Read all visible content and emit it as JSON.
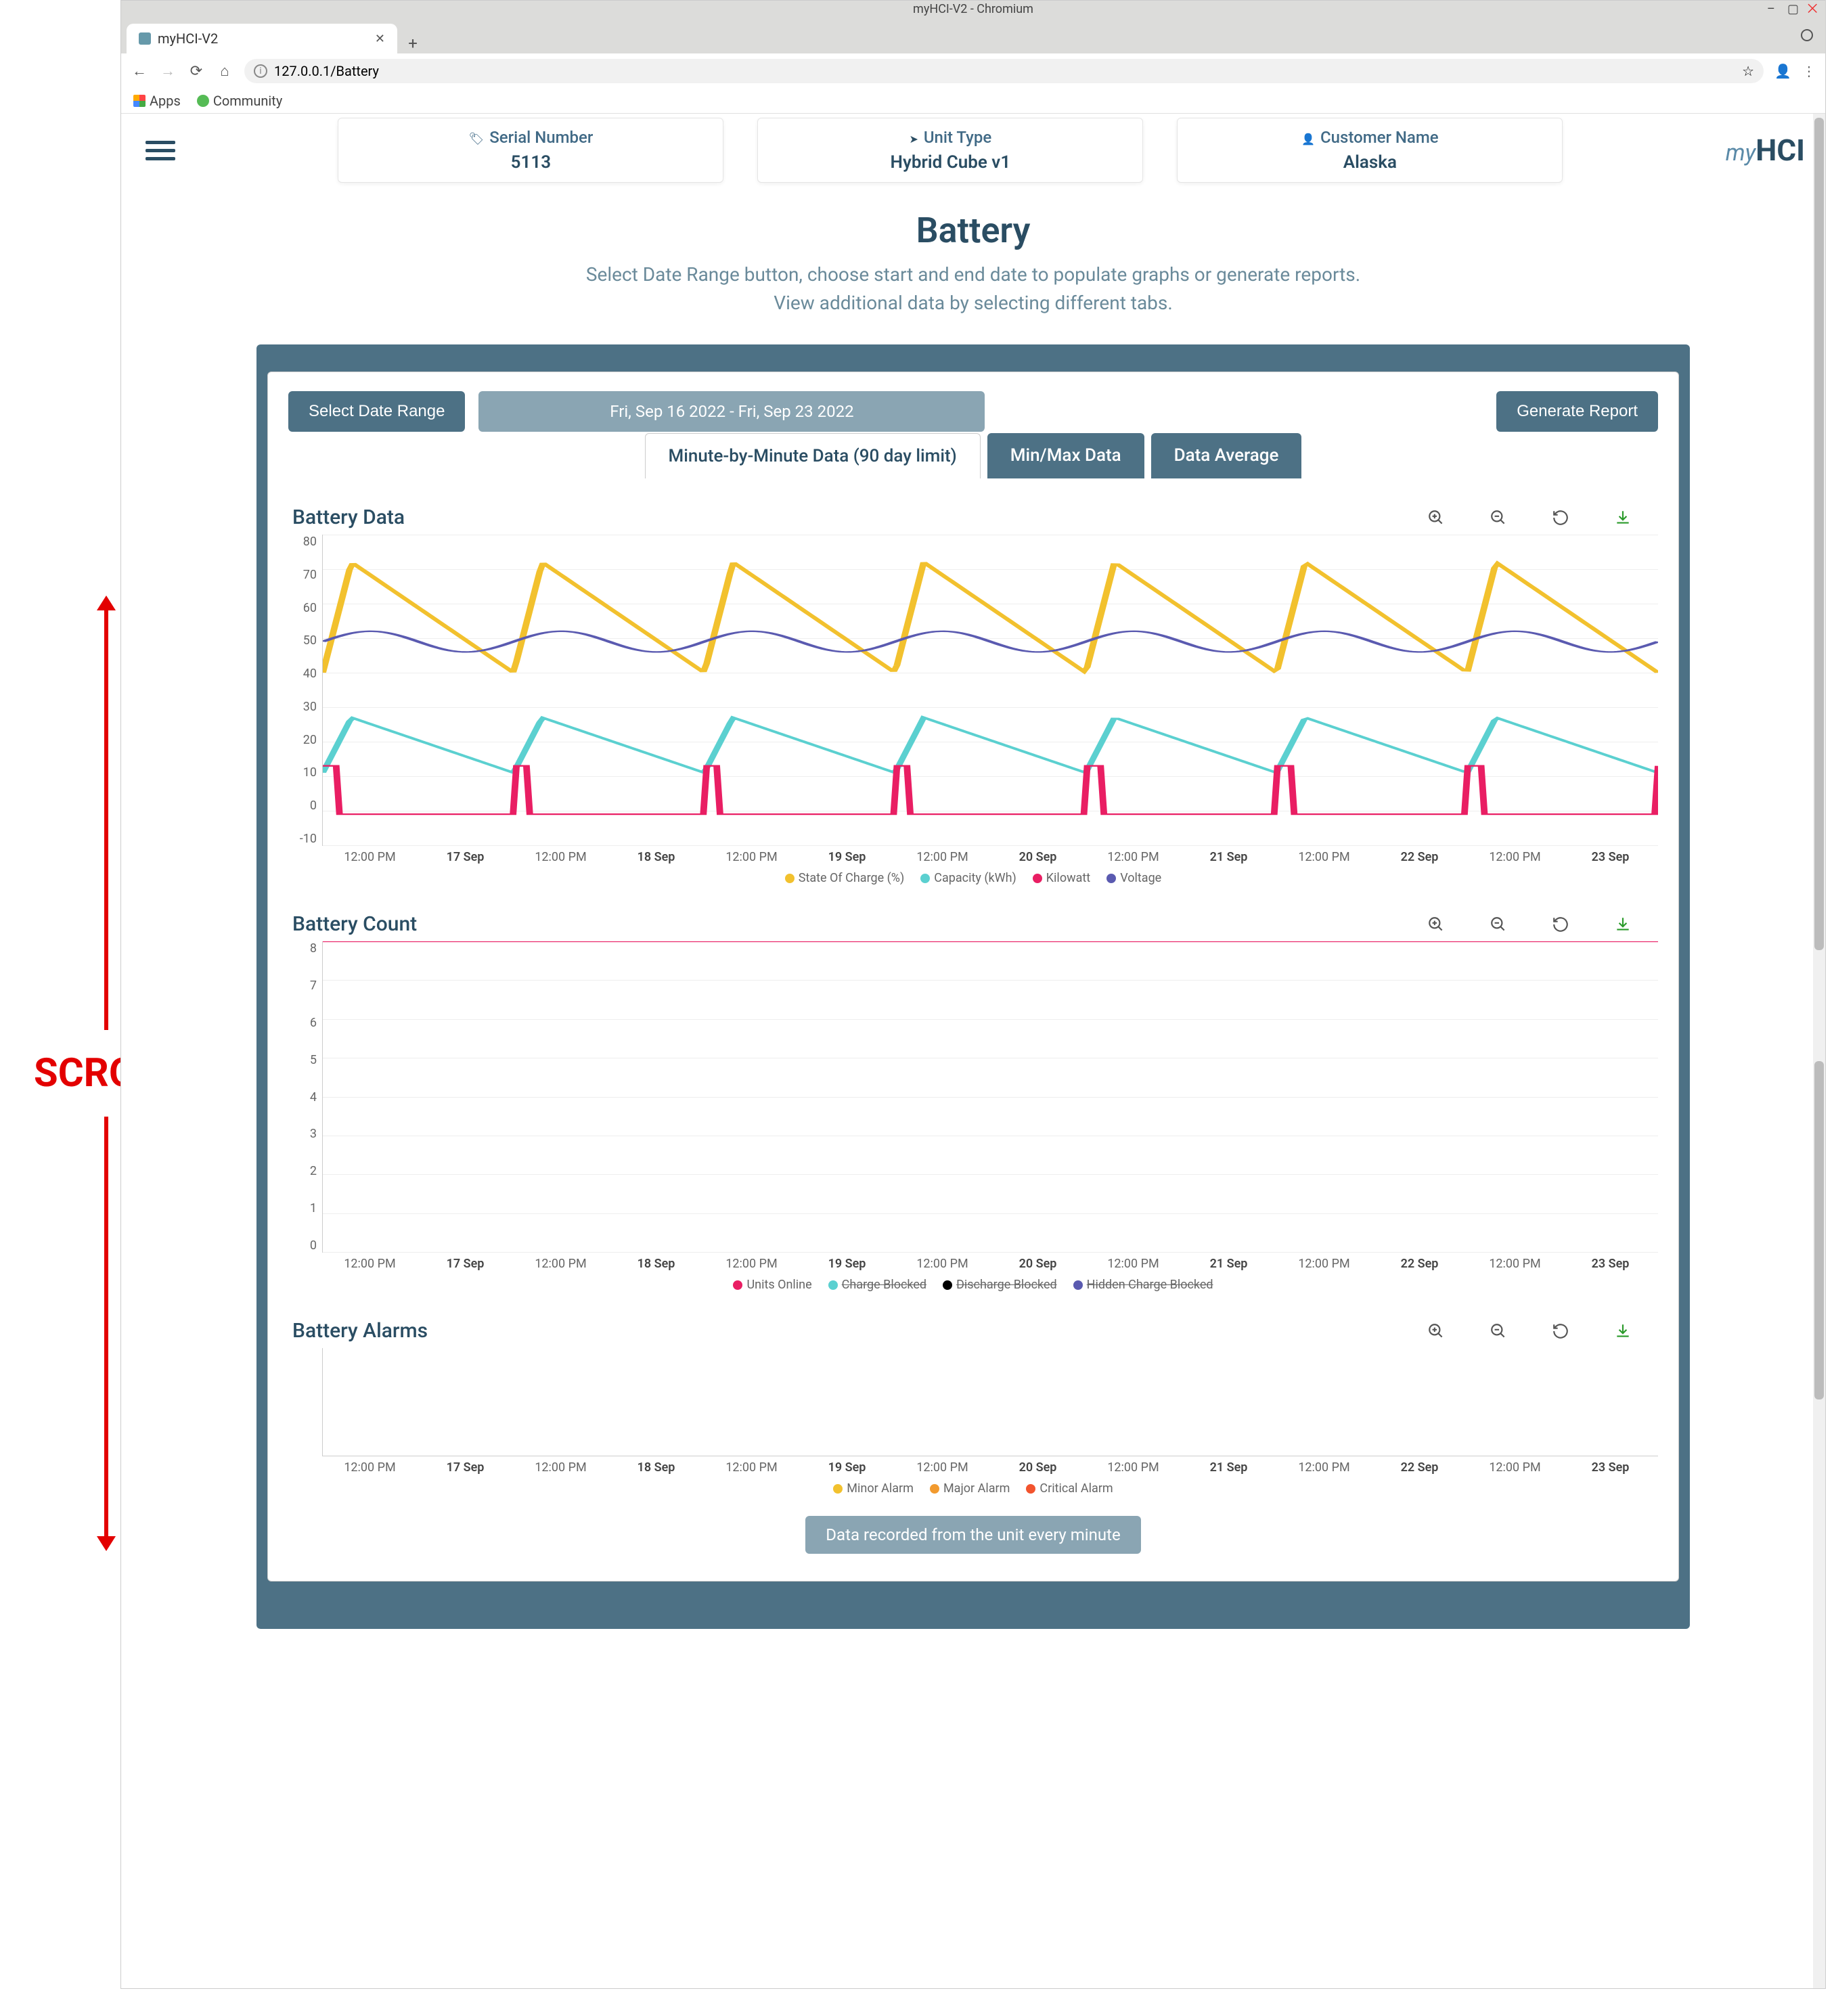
{
  "browser": {
    "window_title": "myHCI-V2 - Chromium",
    "tab_title": "myHCI-V2",
    "url": "127.0.0.1/Battery",
    "bookmarks": {
      "apps": "Apps",
      "community": "Community"
    }
  },
  "annotation": {
    "scroll": "SCROLL"
  },
  "header": {
    "cards": {
      "serial": {
        "label": "Serial Number",
        "value": "5113"
      },
      "unit": {
        "label": "Unit Type",
        "value": "Hybrid Cube v1"
      },
      "cust": {
        "label": "Customer Name",
        "value": "Alaska"
      }
    },
    "logo_my": "my",
    "logo_hci": "HCI"
  },
  "page": {
    "title": "Battery",
    "sub1": "Select Date Range button, choose start and end date to populate graphs or generate reports.",
    "sub2": "View additional data by selecting different tabs."
  },
  "controls": {
    "select_range": "Select Date Range",
    "date_display": "Fri, Sep 16 2022 - Fri, Sep 23 2022",
    "generate": "Generate Report"
  },
  "tabs": {
    "t1": "Minute-by-Minute Data (90 day limit)",
    "t2": "Min/Max Data",
    "t3": "Data Average"
  },
  "chart_data": [
    {
      "id": "battery-data",
      "title": "Battery Data",
      "type": "line",
      "ylim": [
        -10,
        80
      ],
      "yticks": [
        "80",
        "70",
        "60",
        "50",
        "40",
        "30",
        "20",
        "10",
        "0",
        "-10"
      ],
      "xticks": [
        "12:00 PM",
        "17 Sep",
        "12:00 PM",
        "18 Sep",
        "12:00 PM",
        "19 Sep",
        "12:00 PM",
        "20 Sep",
        "12:00 PM",
        "21 Sep",
        "12:00 PM",
        "22 Sep",
        "12:00 PM",
        "23 Sep"
      ],
      "series": [
        {
          "name": "State Of Charge (%)",
          "color": "#f2c12e",
          "pattern": "sawtooth",
          "lo": 40,
          "hi": 72,
          "cycles": 7,
          "phase": 0
        },
        {
          "name": "Capacity (kWh)",
          "color": "#5bd0d0",
          "pattern": "sawtooth",
          "lo": 11,
          "hi": 27,
          "cycles": 7,
          "phase": 0
        },
        {
          "name": "Kilowatt",
          "color": "#e91e63",
          "pattern": "pulse",
          "lo": -1,
          "hi": 13,
          "cycles": 7,
          "phase": 0
        },
        {
          "name": "Voltage",
          "color": "#5a5ab0",
          "pattern": "ripple",
          "lo": 46,
          "hi": 52,
          "cycles": 7,
          "phase": 0
        }
      ]
    },
    {
      "id": "battery-count",
      "title": "Battery Count",
      "type": "line",
      "ylim": [
        0,
        8
      ],
      "yticks": [
        "8",
        "7",
        "6",
        "5",
        "4",
        "3",
        "2",
        "1",
        "0"
      ],
      "xticks": [
        "12:00 PM",
        "17 Sep",
        "12:00 PM",
        "18 Sep",
        "12:00 PM",
        "19 Sep",
        "12:00 PM",
        "20 Sep",
        "12:00 PM",
        "21 Sep",
        "12:00 PM",
        "22 Sep",
        "12:00 PM",
        "23 Sep"
      ],
      "series": [
        {
          "name": "Units Online",
          "color": "#e91e63",
          "pattern": "flat",
          "lo": 8,
          "hi": 8
        },
        {
          "name": "Charge Blocked",
          "color": "#5bd0d0",
          "pattern": "hidden",
          "strike": true
        },
        {
          "name": "Discharge Blocked",
          "color": "#000000",
          "pattern": "hidden",
          "strike": true
        },
        {
          "name": "Hidden Charge Blocked",
          "color": "#5a5ab0",
          "pattern": "hidden",
          "strike": true
        }
      ]
    },
    {
      "id": "battery-alarms",
      "title": "Battery Alarms",
      "type": "line",
      "ylim": [
        0,
        1
      ],
      "yticks": [],
      "xticks": [
        "12:00 PM",
        "17 Sep",
        "12:00 PM",
        "18 Sep",
        "12:00 PM",
        "19 Sep",
        "12:00 PM",
        "20 Sep",
        "12:00 PM",
        "21 Sep",
        "12:00 PM",
        "22 Sep",
        "12:00 PM",
        "23 Sep"
      ],
      "series": [
        {
          "name": "Minor Alarm",
          "color": "#f2c12e",
          "pattern": "hidden"
        },
        {
          "name": "Major Alarm",
          "color": "#f29a2e",
          "pattern": "hidden"
        },
        {
          "name": "Critical Alarm",
          "color": "#f2542e",
          "pattern": "hidden"
        }
      ]
    }
  ],
  "footer": {
    "note": "Data recorded from the unit every minute"
  }
}
